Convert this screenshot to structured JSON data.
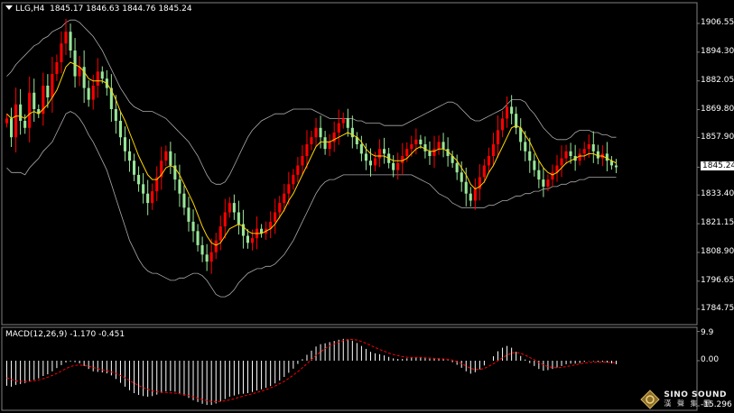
{
  "header": {
    "symbol": "LLG,H4",
    "ohlc": "1845.17 1846.63 1844.76 1845.24"
  },
  "macd_header": {
    "label": "MACD(12,26,9) -1.170 -0.451"
  },
  "logo": {
    "en": "SINO SOUND",
    "cn": "漢 聲 集 團"
  },
  "colors": {
    "background": "#000000",
    "up_candle": "#ff0000",
    "down_candle": "#98e698",
    "fast_ma": "#ffd400",
    "bands": "#aaaaaa",
    "macd_hist": "#ffffff",
    "macd_signal": "#ff0000"
  },
  "chart_data": [
    {
      "type": "candlestick",
      "title": "LLG,H4",
      "price_axis": {
        "ylim": [
          1778.5,
          1915.0
        ],
        "ticks": [
          "1906.55",
          "1894.30",
          "1882.05",
          "1869.80",
          "1857.90",
          "1845.24",
          "1833.40",
          "1821.15",
          "1808.90",
          "1796.65",
          "1784.75"
        ],
        "tick_values": [
          1906.55,
          1894.3,
          1882.05,
          1869.8,
          1857.9,
          1845.24,
          1833.4,
          1821.15,
          1808.9,
          1796.65,
          1784.75
        ],
        "last_price": 1845.24
      },
      "close": [
        1866,
        1858,
        1872,
        1865,
        1862,
        1877,
        1870,
        1868,
        1880,
        1875,
        1885,
        1890,
        1898,
        1903,
        1895,
        1884,
        1888,
        1879,
        1874,
        1880,
        1886,
        1883,
        1879,
        1870,
        1865,
        1858,
        1852,
        1848,
        1842,
        1838,
        1834,
        1830,
        1835,
        1841,
        1848,
        1852,
        1846,
        1840,
        1834,
        1828,
        1822,
        1818,
        1812,
        1808,
        1805,
        1809,
        1814,
        1820,
        1826,
        1830,
        1826,
        1821,
        1816,
        1813,
        1815,
        1819,
        1817,
        1819,
        1822,
        1826,
        1830,
        1834,
        1838,
        1842,
        1846,
        1850,
        1855,
        1858,
        1862,
        1858,
        1853,
        1856,
        1860,
        1864,
        1866,
        1862,
        1858,
        1855,
        1851,
        1848,
        1846,
        1849,
        1853,
        1851,
        1847,
        1844,
        1847,
        1850,
        1853,
        1855,
        1857,
        1855,
        1852,
        1850,
        1853,
        1856,
        1853,
        1850,
        1847,
        1843,
        1839,
        1834,
        1831,
        1836,
        1841,
        1846,
        1850,
        1855,
        1861,
        1866,
        1871,
        1868,
        1862,
        1856,
        1852,
        1848,
        1844,
        1840,
        1837,
        1840,
        1843,
        1846,
        1849,
        1852,
        1850,
        1848,
        1851,
        1853,
        1855,
        1852,
        1849,
        1851,
        1848,
        1846,
        1845.24
      ],
      "ma_fast": [
        1868,
        1866,
        1867,
        1867,
        1866,
        1868,
        1869,
        1868,
        1870,
        1872,
        1875,
        1878,
        1883,
        1888,
        1890,
        1889,
        1888,
        1886,
        1883,
        1882,
        1882,
        1882,
        1881,
        1878,
        1874,
        1869,
        1865,
        1860,
        1855,
        1850,
        1846,
        1842,
        1840,
        1840,
        1842,
        1845,
        1846,
        1845,
        1842,
        1838,
        1834,
        1830,
        1825,
        1820,
        1816,
        1813,
        1812,
        1813,
        1816,
        1819,
        1820,
        1821,
        1820,
        1818,
        1817,
        1817,
        1817,
        1818,
        1819,
        1821,
        1824,
        1827,
        1831,
        1834,
        1838,
        1842,
        1846,
        1850,
        1854,
        1856,
        1856,
        1856,
        1857,
        1858,
        1859,
        1860,
        1859,
        1858,
        1856,
        1853,
        1851,
        1850,
        1850,
        1850,
        1849,
        1848,
        1848,
        1848,
        1849,
        1851,
        1853,
        1854,
        1853,
        1852,
        1852,
        1853,
        1853,
        1852,
        1850,
        1848,
        1845,
        1842,
        1838,
        1836,
        1837,
        1839,
        1843,
        1846,
        1850,
        1854,
        1858,
        1862,
        1863,
        1862,
        1859,
        1856,
        1852,
        1848,
        1845,
        1843,
        1842,
        1843,
        1845,
        1847,
        1848,
        1849,
        1850,
        1850,
        1851,
        1851,
        1850,
        1850,
        1849,
        1848,
        1847
      ],
      "band_upper": [
        1884,
        1886,
        1889,
        1891,
        1893,
        1895,
        1897,
        1898,
        1900,
        1901,
        1903,
        1904,
        1905,
        1907,
        1908,
        1908,
        1907,
        1905,
        1903,
        1901,
        1898,
        1895,
        1891,
        1887,
        1883,
        1879,
        1876,
        1873,
        1871,
        1870,
        1869,
        1869,
        1869,
        1868,
        1867,
        1866,
        1864,
        1862,
        1860,
        1858,
        1856,
        1853,
        1850,
        1846,
        1842,
        1839,
        1838,
        1838,
        1839,
        1842,
        1846,
        1850,
        1854,
        1858,
        1861,
        1863,
        1865,
        1866,
        1867,
        1868,
        1868,
        1868,
        1869,
        1870,
        1870,
        1870,
        1870,
        1870,
        1869,
        1868,
        1867,
        1866,
        1866,
        1866,
        1866,
        1866,
        1866,
        1865,
        1865,
        1864,
        1864,
        1864,
        1864,
        1863,
        1863,
        1863,
        1863,
        1863,
        1864,
        1865,
        1866,
        1867,
        1868,
        1869,
        1870,
        1871,
        1872,
        1873,
        1873,
        1872,
        1870,
        1868,
        1866,
        1865,
        1865,
        1866,
        1867,
        1868,
        1869,
        1870,
        1872,
        1874,
        1874,
        1874,
        1873,
        1870,
        1868,
        1865,
        1862,
        1860,
        1858,
        1857,
        1857,
        1857,
        1858,
        1860,
        1861,
        1861,
        1861,
        1860,
        1860,
        1859,
        1859,
        1858,
        1858
      ],
      "band_lower": [
        1845,
        1843,
        1843,
        1843,
        1842,
        1845,
        1847,
        1849,
        1852,
        1854,
        1856,
        1860,
        1864,
        1868,
        1869,
        1868,
        1866,
        1863,
        1859,
        1856,
        1852,
        1848,
        1844,
        1838,
        1832,
        1826,
        1820,
        1814,
        1810,
        1806,
        1803,
        1801,
        1800,
        1800,
        1799,
        1798,
        1797,
        1797,
        1798,
        1798,
        1799,
        1800,
        1800,
        1799,
        1797,
        1794,
        1791,
        1790,
        1790,
        1791,
        1793,
        1796,
        1798,
        1800,
        1801,
        1802,
        1802,
        1803,
        1803,
        1804,
        1806,
        1808,
        1811,
        1814,
        1818,
        1822,
        1826,
        1830,
        1834,
        1837,
        1839,
        1840,
        1840,
        1841,
        1842,
        1842,
        1842,
        1842,
        1842,
        1842,
        1842,
        1842,
        1842,
        1842,
        1842,
        1842,
        1842,
        1842,
        1842,
        1842,
        1841,
        1840,
        1839,
        1838,
        1836,
        1834,
        1833,
        1832,
        1830,
        1829,
        1828,
        1828,
        1828,
        1828,
        1828,
        1828,
        1829,
        1829,
        1830,
        1831,
        1831,
        1832,
        1833,
        1833,
        1834,
        1834,
        1835,
        1835,
        1836,
        1836,
        1837,
        1837,
        1838,
        1838,
        1839,
        1839,
        1840,
        1840,
        1841,
        1841,
        1841,
        1841,
        1841,
        1841,
        1841
      ]
    },
    {
      "type": "bar",
      "title": "MACD(12,26,9)",
      "main": -1.17,
      "signal": -0.451,
      "axis": {
        "ticks": [
          "9.9",
          "0.00",
          "-15.296"
        ],
        "tick_values": [
          9.9,
          0,
          -15.296
        ],
        "ylim": [
          -16.5,
          11.0
        ]
      },
      "histogram": [
        -8.5,
        -8.8,
        -8.2,
        -7.9,
        -7.6,
        -7.0,
        -6.5,
        -6.0,
        -5.2,
        -4.6,
        -3.6,
        -2.5,
        -1.5,
        -0.6,
        -0.3,
        -0.5,
        -0.9,
        -1.8,
        -2.8,
        -3.6,
        -3.8,
        -4.0,
        -4.3,
        -5.0,
        -6.2,
        -7.5,
        -8.8,
        -10.0,
        -11.0,
        -11.6,
        -12.0,
        -12.2,
        -12.0,
        -11.5,
        -10.9,
        -10.4,
        -10.3,
        -10.5,
        -11.0,
        -11.8,
        -12.6,
        -13.4,
        -14.0,
        -14.6,
        -15.0,
        -15.0,
        -14.5,
        -13.8,
        -13.0,
        -12.2,
        -11.8,
        -11.4,
        -11.2,
        -11.0,
        -10.6,
        -10.1,
        -9.7,
        -9.2,
        -8.6,
        -7.7,
        -6.7,
        -5.5,
        -4.1,
        -2.7,
        -1.1,
        0.5,
        2.0,
        3.4,
        4.8,
        5.6,
        5.9,
        6.3,
        6.7,
        7.1,
        7.4,
        7.3,
        6.8,
        6.0,
        5.0,
        4.0,
        3.0,
        2.5,
        2.2,
        1.8,
        1.3,
        0.8,
        0.6,
        0.6,
        0.8,
        1.0,
        1.2,
        1.2,
        1.0,
        0.7,
        0.7,
        0.8,
        0.6,
        0.2,
        -0.5,
        -1.4,
        -2.4,
        -3.6,
        -4.4,
        -3.9,
        -2.9,
        -1.6,
        0.0,
        1.5,
        3.2,
        4.4,
        5.0,
        4.4,
        3.0,
        1.6,
        0.4,
        -0.8,
        -1.8,
        -2.8,
        -3.4,
        -3.2,
        -2.8,
        -2.3,
        -1.8,
        -1.2,
        -1.0,
        -1.0,
        -0.8,
        -0.4,
        -0.1,
        -0.2,
        -0.4,
        -0.4,
        -0.6,
        -0.9,
        -1.2
      ],
      "signal_line": [
        -5.8,
        -6.3,
        -6.8,
        -7.0,
        -7.1,
        -7.0,
        -6.8,
        -6.5,
        -6.1,
        -5.6,
        -5.0,
        -4.3,
        -3.5,
        -2.7,
        -2.0,
        -1.6,
        -1.5,
        -1.6,
        -1.9,
        -2.3,
        -2.7,
        -3.1,
        -3.4,
        -3.8,
        -4.3,
        -5.0,
        -5.8,
        -6.7,
        -7.6,
        -8.4,
        -9.1,
        -9.7,
        -10.2,
        -10.5,
        -10.7,
        -10.8,
        -10.9,
        -11.0,
        -11.2,
        -11.5,
        -11.8,
        -12.2,
        -12.7,
        -13.1,
        -13.5,
        -13.8,
        -13.9,
        -13.8,
        -13.6,
        -13.3,
        -12.9,
        -12.4,
        -12.0,
        -11.6,
        -11.2,
        -10.8,
        -10.3,
        -9.8,
        -9.2,
        -8.6,
        -7.8,
        -7.0,
        -6.0,
        -4.9,
        -3.7,
        -2.4,
        -1.0,
        0.4,
        1.8,
        3.0,
        4.1,
        5.0,
        5.7,
        6.3,
        6.8,
        7.1,
        7.2,
        7.0,
        6.5,
        5.9,
        5.2,
        4.5,
        3.8,
        3.2,
        2.6,
        2.1,
        1.7,
        1.4,
        1.2,
        1.1,
        1.1,
        1.1,
        1.0,
        0.9,
        0.8,
        0.7,
        0.6,
        0.5,
        0.2,
        -0.3,
        -1.0,
        -1.8,
        -2.6,
        -3.0,
        -3.0,
        -2.6,
        -1.9,
        -1.0,
        0.0,
        1.0,
        1.9,
        2.6,
        2.8,
        2.5,
        1.9,
        1.1,
        0.3,
        -0.6,
        -1.4,
        -2.0,
        -2.3,
        -2.4,
        -2.3,
        -2.0,
        -1.7,
        -1.4,
        -1.1,
        -0.8,
        -0.6,
        -0.5,
        -0.5,
        -0.5,
        -0.5,
        -0.6,
        -0.7
      ]
    }
  ]
}
